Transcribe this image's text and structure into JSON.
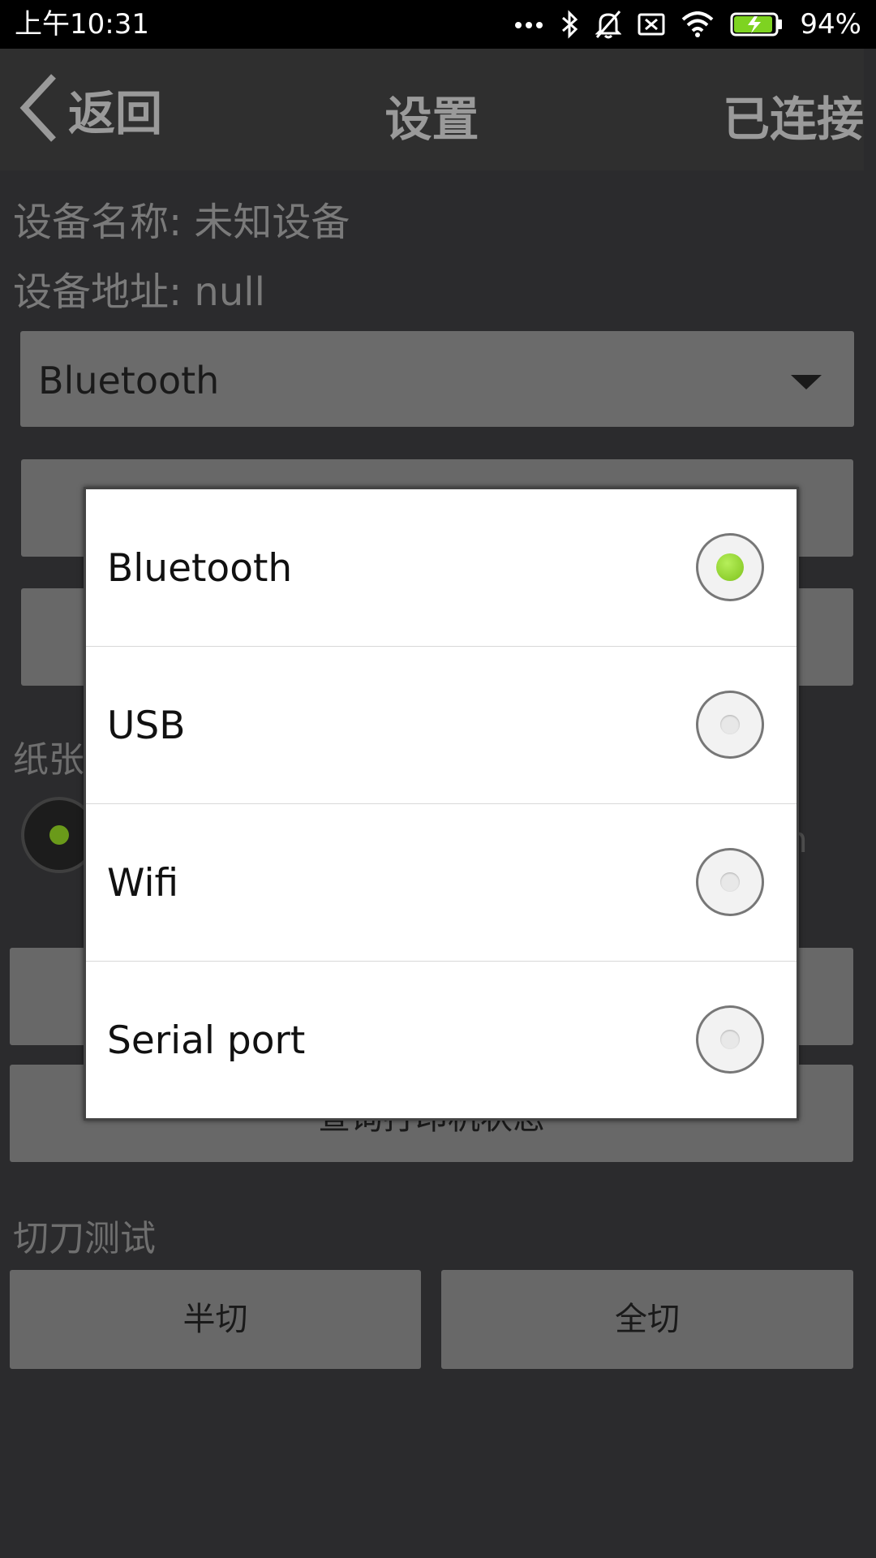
{
  "status_bar": {
    "time": "上午10:31",
    "battery_percent": "94%",
    "icons": [
      "more-dots-icon",
      "bluetooth-icon",
      "bell-muted-icon",
      "sim-off-icon",
      "wifi-icon",
      "battery-charging-icon"
    ],
    "battery_level": 0.94,
    "battery_color": "#7ed321"
  },
  "header": {
    "back_label": "返回",
    "title": "设置",
    "connection_status": "已连接"
  },
  "device": {
    "name_line": "设备名称: 未知设备",
    "address_line": "设备地址: null"
  },
  "connection_select": {
    "selected_value": "Bluetooth"
  },
  "background": {
    "paper_label": "纸张",
    "paper_suffix": "n",
    "status_button_label": "查询打印机状态",
    "cutter_section_label": "切刀测试",
    "half_cut_label": "半切",
    "full_cut_label": "全切"
  },
  "dialog": {
    "options": [
      {
        "label": "Bluetooth",
        "selected": true
      },
      {
        "label": "USB",
        "selected": false
      },
      {
        "label": "Wifi",
        "selected": false
      },
      {
        "label": "Serial port",
        "selected": false
      }
    ],
    "selected_color": "#8bd02a"
  }
}
